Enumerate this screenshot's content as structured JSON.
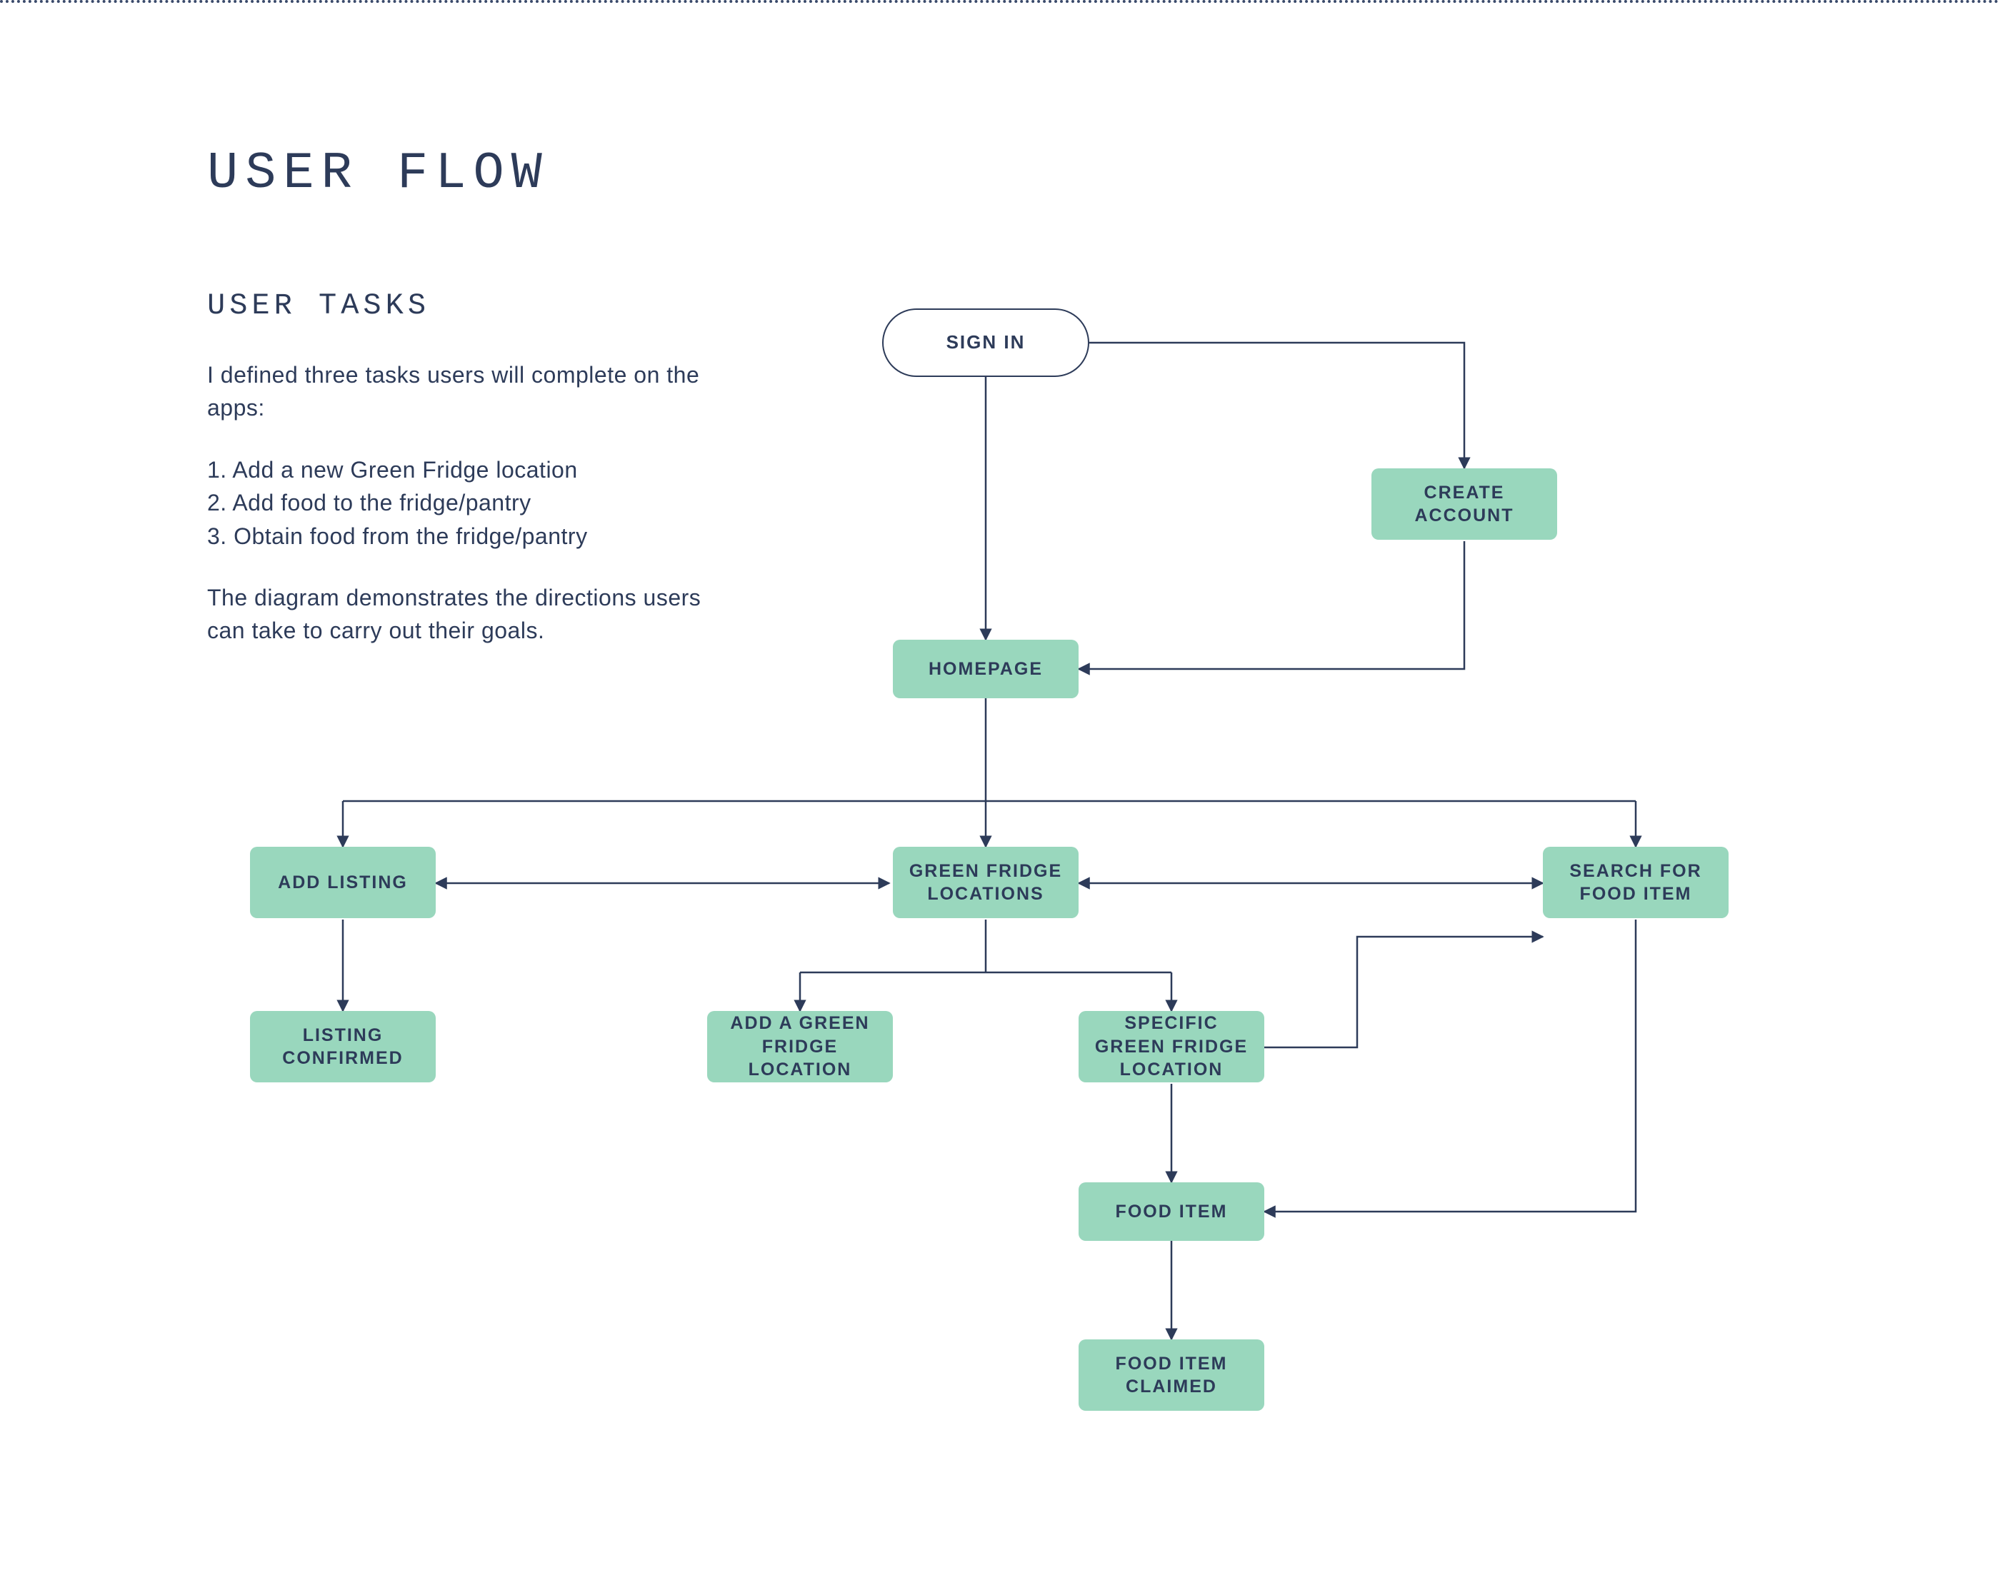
{
  "title": "USER FLOW",
  "section_title": "USER TASKS",
  "intro": "I defined three tasks users will complete on the apps:",
  "tasks": [
    "Add a new Green Fridge location",
    "Add food to the fridge/pantry",
    "Obtain food from the fridge/pantry"
  ],
  "outro": "The diagram demonstrates the directions users can take to carry out their goals.",
  "nodes": {
    "sign_in": "SIGN IN",
    "create_account": "CREATE ACCOUNT",
    "homepage": "HOMEPAGE",
    "add_listing": "ADD LISTING",
    "listing_confirmed": "LISTING CONFIRMED",
    "gf_locations": "GREEN FRIDGE LOCATIONS",
    "add_gf_location": "ADD A GREEN FRIDGE LOCATION",
    "specific_gf": "SPECIFIC GREEN FRIDGE LOCATION",
    "search_food": "SEARCH FOR FOOD ITEM",
    "food_item": "FOOD ITEM",
    "food_claimed": "FOOD ITEM CLAIMED"
  },
  "colors": {
    "navy": "#2d3b59",
    "mint": "#99d7bd"
  }
}
